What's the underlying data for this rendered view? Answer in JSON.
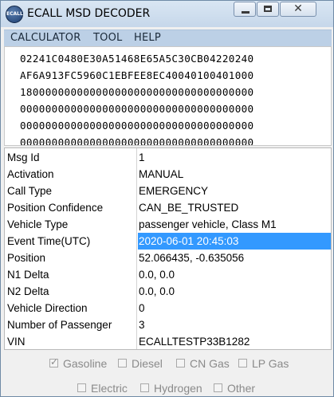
{
  "window": {
    "title": "ECALL MSD DECODER",
    "icon_text": "ECALL",
    "controls": {
      "minimize": "minimize-icon",
      "maximize": "maximize-icon",
      "close": "✕"
    }
  },
  "menu": {
    "items": [
      {
        "label": "CALCULATOR"
      },
      {
        "label": "TOOL"
      },
      {
        "label": "HELP"
      }
    ]
  },
  "hex": {
    "lines": [
      "02241C0480E30A51468E65A5C30CB04220240",
      "AF6A913FC5960C1EBFEE8EC40040100401000",
      "1800000000000000000000000000000000000",
      "0000000000000000000000000000000000000",
      "0000000000000000000000000000000000000",
      "0000000000000000000000000000000000000",
      "0000000000000000000000000000000000000"
    ]
  },
  "fields": [
    {
      "label": "Msg Id",
      "value": "1"
    },
    {
      "label": "Activation",
      "value": "MANUAL"
    },
    {
      "label": "Call Type",
      "value": "EMERGENCY"
    },
    {
      "label": "Position Confidence",
      "value": "CAN_BE_TRUSTED"
    },
    {
      "label": "Vehicle Type",
      "value": "passenger vehicle, Class M1"
    },
    {
      "label": "Event Time(UTC)",
      "value": "2020-06-01 20:45:03",
      "selected": true
    },
    {
      "label": "Position",
      "value": "52.066435, -0.635056"
    },
    {
      "label": "N1 Delta",
      "value": "0.0, 0.0"
    },
    {
      "label": "N2 Delta",
      "value": "0.0, 0.0"
    },
    {
      "label": "Vehicle Direction",
      "value": "0"
    },
    {
      "label": "Number of Passenger",
      "value": "3"
    },
    {
      "label": "VIN",
      "value": "ECALLTESTP33B1282"
    }
  ],
  "fuel_types": [
    {
      "label": "Gasoline",
      "checked": true
    },
    {
      "label": "Diesel",
      "checked": false
    },
    {
      "label": "CN Gas",
      "checked": false
    },
    {
      "label": "LP Gas",
      "checked": false
    },
    {
      "label": "Electric",
      "checked": false
    },
    {
      "label": "Hydrogen",
      "checked": false
    },
    {
      "label": "Other",
      "checked": false
    }
  ],
  "colors": {
    "selection": "#3399ff",
    "menubar": "#bcd0e6",
    "titlebar": "#c6d7ea"
  }
}
